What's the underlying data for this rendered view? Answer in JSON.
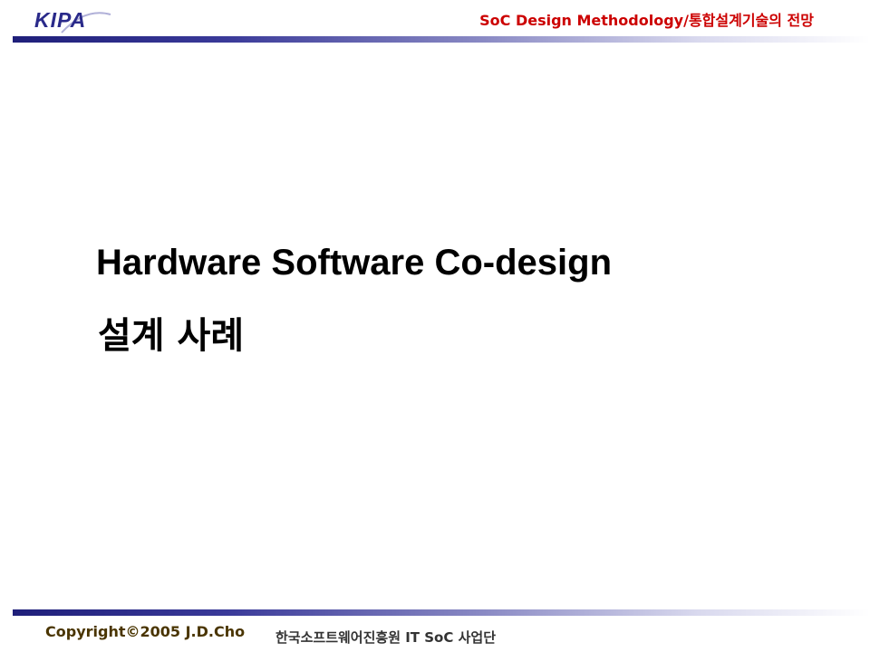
{
  "header": {
    "logo_text": "KIPA",
    "title": "SoC Design Methodology/통합설계기술의 전망"
  },
  "slide": {
    "title": "Hardware Software Co-design",
    "subtitle": "설계 사례"
  },
  "footer": {
    "copyright": "Copyright©2005 J.D.Cho",
    "organization": "한국소프트웨어진흥원  IT SoC 사업단"
  },
  "colors": {
    "header_title": "#cc0000",
    "logo": "#2a2a8a",
    "rule_dark": "#1f1f7a",
    "copyright": "#4a3500"
  },
  "icons": {
    "logo": "kipa-logo"
  }
}
